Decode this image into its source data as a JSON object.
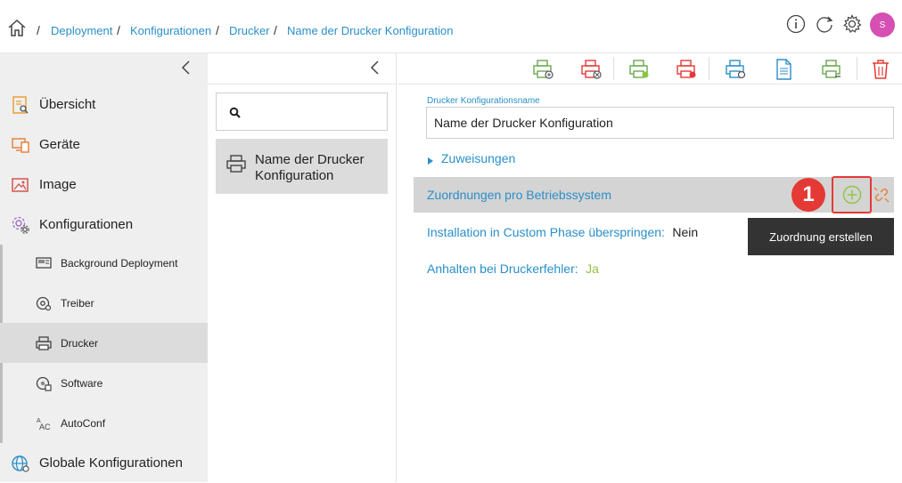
{
  "breadcrumb": {
    "items": [
      "Deployment",
      "Konfigurationen",
      "Drucker",
      "Name der Drucker Konfiguration"
    ],
    "separator": "/"
  },
  "header": {
    "avatar_letter": "S",
    "icons": [
      "info-icon",
      "refresh-icon",
      "settings-icon"
    ]
  },
  "sidebar": {
    "main_items": [
      {
        "label": "Übersicht",
        "icon": "overview-icon"
      },
      {
        "label": "Geräte",
        "icon": "devices-icon"
      },
      {
        "label": "Image",
        "icon": "image-icon"
      },
      {
        "label": "Konfigurationen",
        "icon": "configurations-icon"
      }
    ],
    "sub_items": [
      {
        "label": "Background Deployment",
        "icon": "background-deployment-icon"
      },
      {
        "label": "Treiber",
        "icon": "driver-icon"
      },
      {
        "label": "Drucker",
        "icon": "printer-icon",
        "active": true
      },
      {
        "label": "Software",
        "icon": "software-icon"
      },
      {
        "label": "AutoConf",
        "icon": "autoconf-icon"
      }
    ],
    "bottom_item": {
      "label": "Globale Konfigurationen",
      "icon": "global-configurations-icon"
    }
  },
  "list_panel": {
    "search_placeholder": "",
    "items": [
      {
        "label": "Name der Drucker Konfiguration",
        "icon": "printer-icon",
        "selected": true
      }
    ]
  },
  "toolbar": {
    "icons": [
      "printer-add-green-icon",
      "printer-remove-red-icon",
      "printer-add-green-2-icon",
      "printer-remove-red-2-icon",
      "printer-settings-blue-icon",
      "document-copy-blue-icon",
      "printer-green-3-icon",
      "trash-icon"
    ]
  },
  "form": {
    "name_label": "Drucker Konfigurationsname",
    "name_value": "Name der Drucker Konfiguration",
    "assignments_label": "Zuweisungen",
    "os_mapping_label": "Zuordnungen pro Betriebssystem",
    "skip_custom_phase_label": "Installation in Custom Phase überspringen:",
    "skip_custom_phase_value": "Nein",
    "halt_on_error_label": "Anhalten bei Druckerfehler:",
    "halt_on_error_value": "Ja"
  },
  "annotation": {
    "step_number": "1",
    "tooltip": "Zuordnung erstellen"
  },
  "colors": {
    "accent_blue": "#2a8fc9",
    "green": "#8cc63f",
    "red": "#e53935",
    "avatar": "#d64fb3",
    "tooltip_bg": "#333333"
  }
}
